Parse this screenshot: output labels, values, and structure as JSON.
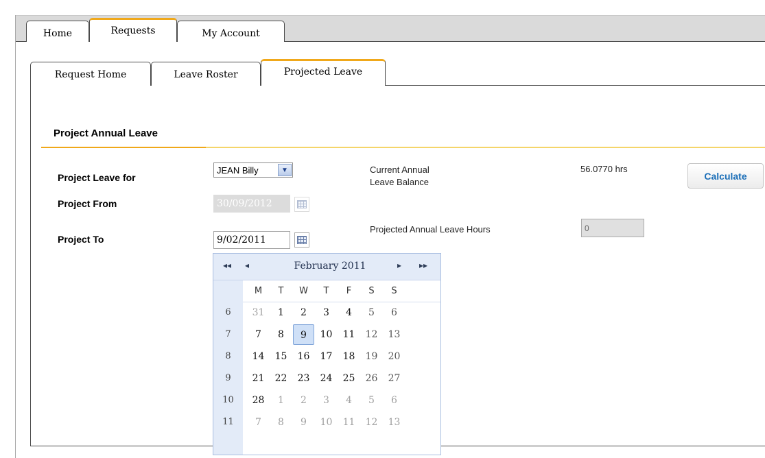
{
  "main_tabs": [
    {
      "label": "Home"
    },
    {
      "label": "Requests"
    },
    {
      "label": "My Account"
    }
  ],
  "sub_tabs": [
    {
      "label": "Request Home"
    },
    {
      "label": "Leave Roster"
    },
    {
      "label": "Projected Leave"
    }
  ],
  "section_title": "Project Annual Leave",
  "form": {
    "leave_for_label": "Project Leave for",
    "leave_for_value": "JEAN Billy",
    "from_label": "Project From",
    "from_value": "30/09/2012",
    "to_label": "Project To",
    "to_value": "9/02/2011",
    "balance_label_line1": "Current Annual",
    "balance_label_line2": "Leave Balance",
    "balance_value": "56.0770 hrs",
    "calculate_label": "Calculate",
    "projected_label": "Projected Annual Leave Hours",
    "projected_value": "0"
  },
  "calendar": {
    "title": "February 2011",
    "nav": {
      "prev_year": "◂◂",
      "prev_month": "◂",
      "next_month": "▸",
      "next_year": "▸▸"
    },
    "weekdays": [
      "M",
      "T",
      "W",
      "T",
      "F",
      "S",
      "S"
    ],
    "weeks": [
      {
        "num": "6",
        "days": [
          {
            "d": "31",
            "o": true
          },
          {
            "d": "1"
          },
          {
            "d": "2"
          },
          {
            "d": "3"
          },
          {
            "d": "4"
          },
          {
            "d": "5",
            "w": true
          },
          {
            "d": "6",
            "w": true
          }
        ]
      },
      {
        "num": "7",
        "days": [
          {
            "d": "7"
          },
          {
            "d": "8"
          },
          {
            "d": "9",
            "sel": true
          },
          {
            "d": "10"
          },
          {
            "d": "11"
          },
          {
            "d": "12",
            "w": true
          },
          {
            "d": "13",
            "w": true
          }
        ]
      },
      {
        "num": "8",
        "days": [
          {
            "d": "14"
          },
          {
            "d": "15"
          },
          {
            "d": "16"
          },
          {
            "d": "17"
          },
          {
            "d": "18"
          },
          {
            "d": "19",
            "w": true
          },
          {
            "d": "20",
            "w": true
          }
        ]
      },
      {
        "num": "9",
        "days": [
          {
            "d": "21"
          },
          {
            "d": "22"
          },
          {
            "d": "23"
          },
          {
            "d": "24"
          },
          {
            "d": "25"
          },
          {
            "d": "26",
            "w": true
          },
          {
            "d": "27",
            "w": true
          }
        ]
      },
      {
        "num": "10",
        "days": [
          {
            "d": "28"
          },
          {
            "d": "1",
            "o": true
          },
          {
            "d": "2",
            "o": true
          },
          {
            "d": "3",
            "o": true
          },
          {
            "d": "4",
            "o": true
          },
          {
            "d": "5",
            "o": true
          },
          {
            "d": "6",
            "o": true
          }
        ]
      },
      {
        "num": "11",
        "days": [
          {
            "d": "7",
            "o": true
          },
          {
            "d": "8",
            "o": true
          },
          {
            "d": "9",
            "o": true
          },
          {
            "d": "10",
            "o": true
          },
          {
            "d": "11",
            "o": true
          },
          {
            "d": "12",
            "o": true
          },
          {
            "d": "13",
            "o": true
          }
        ]
      }
    ]
  },
  "colors": {
    "accent": "#f0a81a",
    "link": "#1c6fb8",
    "calendar_header": "#e3ebf8"
  }
}
